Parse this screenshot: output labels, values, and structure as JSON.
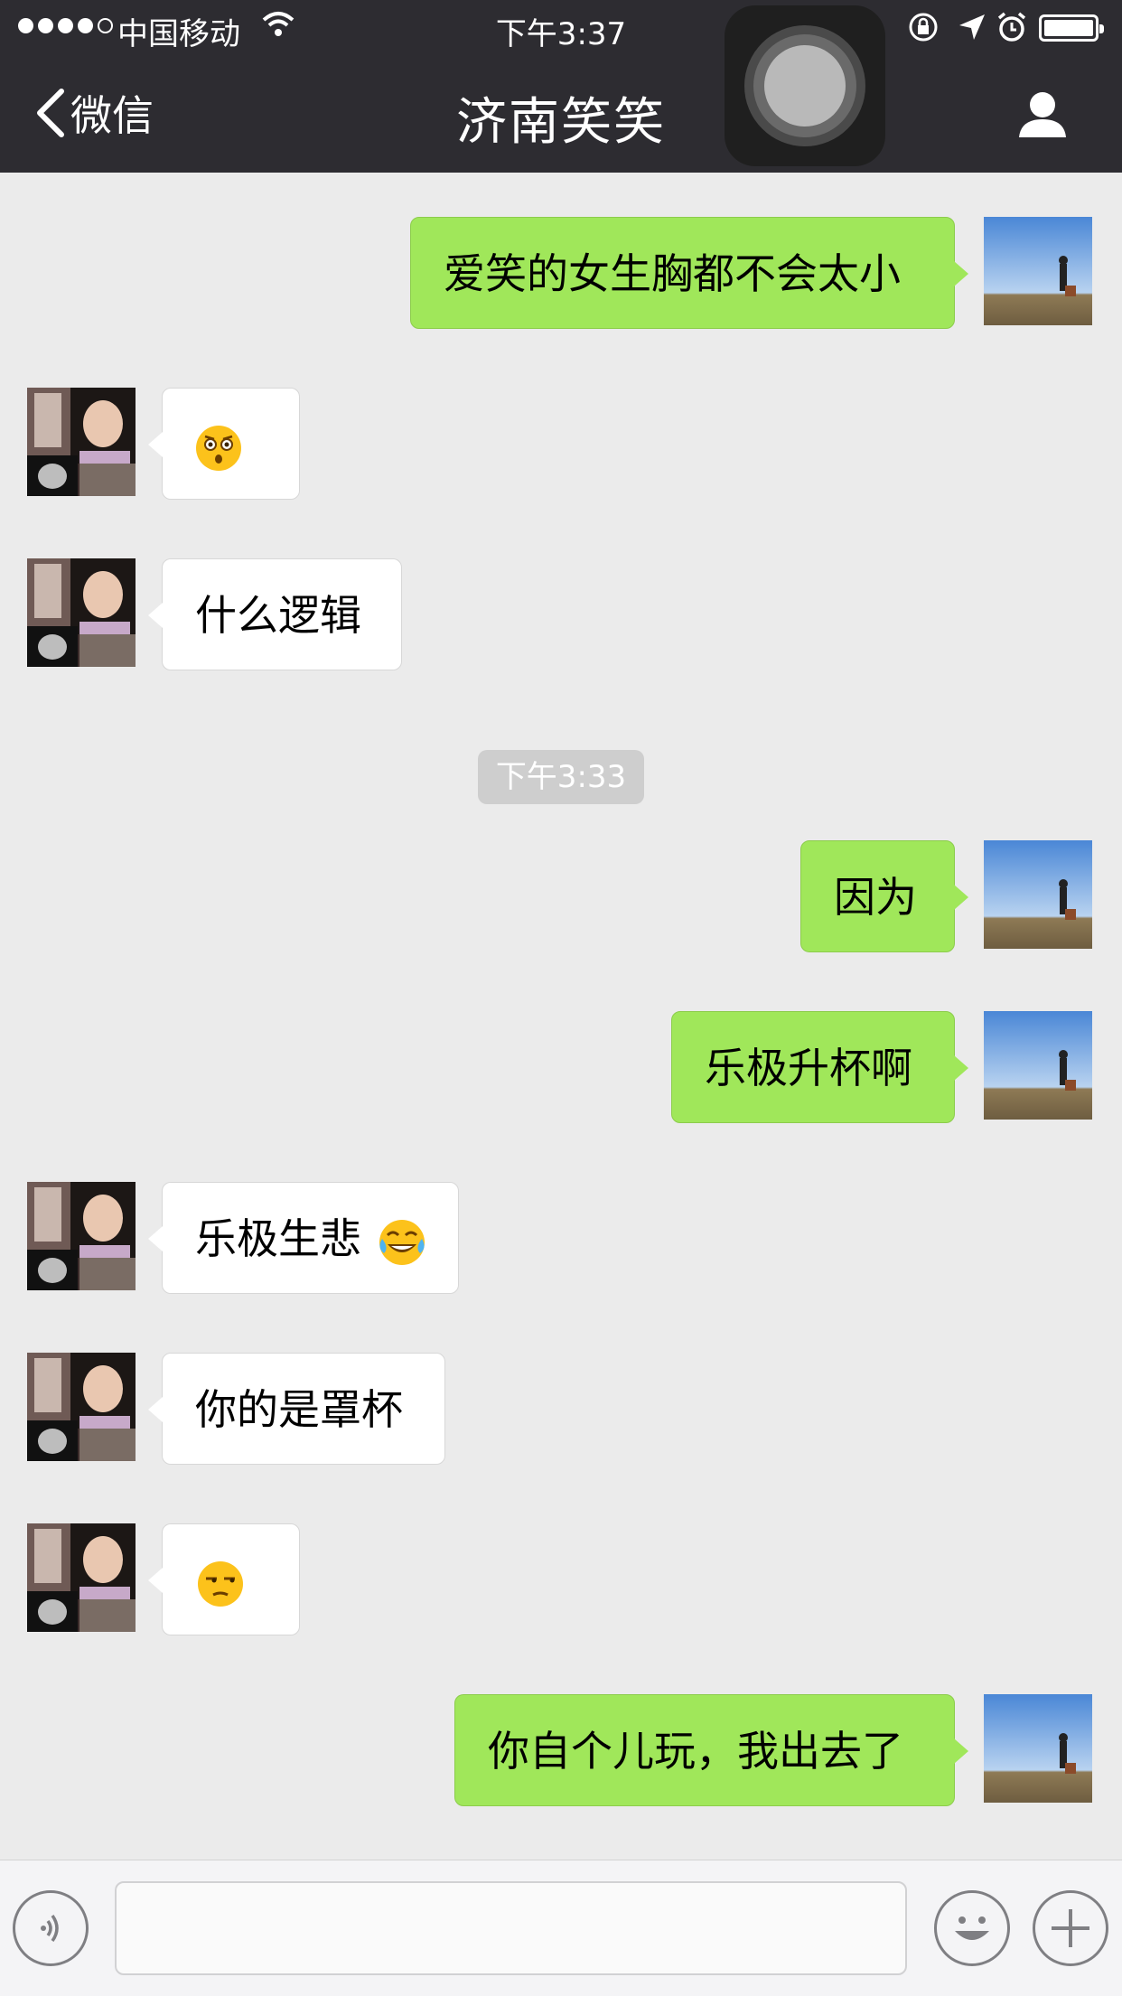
{
  "status_bar": {
    "carrier": "中国移动",
    "time": "下午3:37"
  },
  "nav": {
    "back_label": "微信",
    "title": "济南笑笑"
  },
  "messages": [
    {
      "from": "me",
      "text": "爱笑的女生胸都不会太小"
    },
    {
      "from": "other",
      "emoji": "astonished-face-emoji"
    },
    {
      "from": "other",
      "text": "什么逻辑"
    },
    {
      "from": "me",
      "text": "因为"
    },
    {
      "from": "me",
      "text": "乐极升杯啊"
    },
    {
      "from": "other",
      "text": "乐极生悲",
      "emoji": "tears-of-joy-emoji"
    },
    {
      "from": "other",
      "text": "你的是罩杯"
    },
    {
      "from": "other",
      "emoji": "unamused-face-emoji"
    },
    {
      "from": "me",
      "text": "你自个儿玩，我出去了"
    }
  ],
  "timestamp": "下午3:33",
  "input": {
    "value": "",
    "voice_icon": "voice-icon",
    "emoji_icon": "emoji-icon",
    "add_icon": "plus-icon"
  },
  "colors": {
    "nav_bg": "#2d2c31",
    "chat_bg": "#ebebeb",
    "outgoing_bubble": "#a0e75a",
    "incoming_bubble": "#ffffff"
  }
}
